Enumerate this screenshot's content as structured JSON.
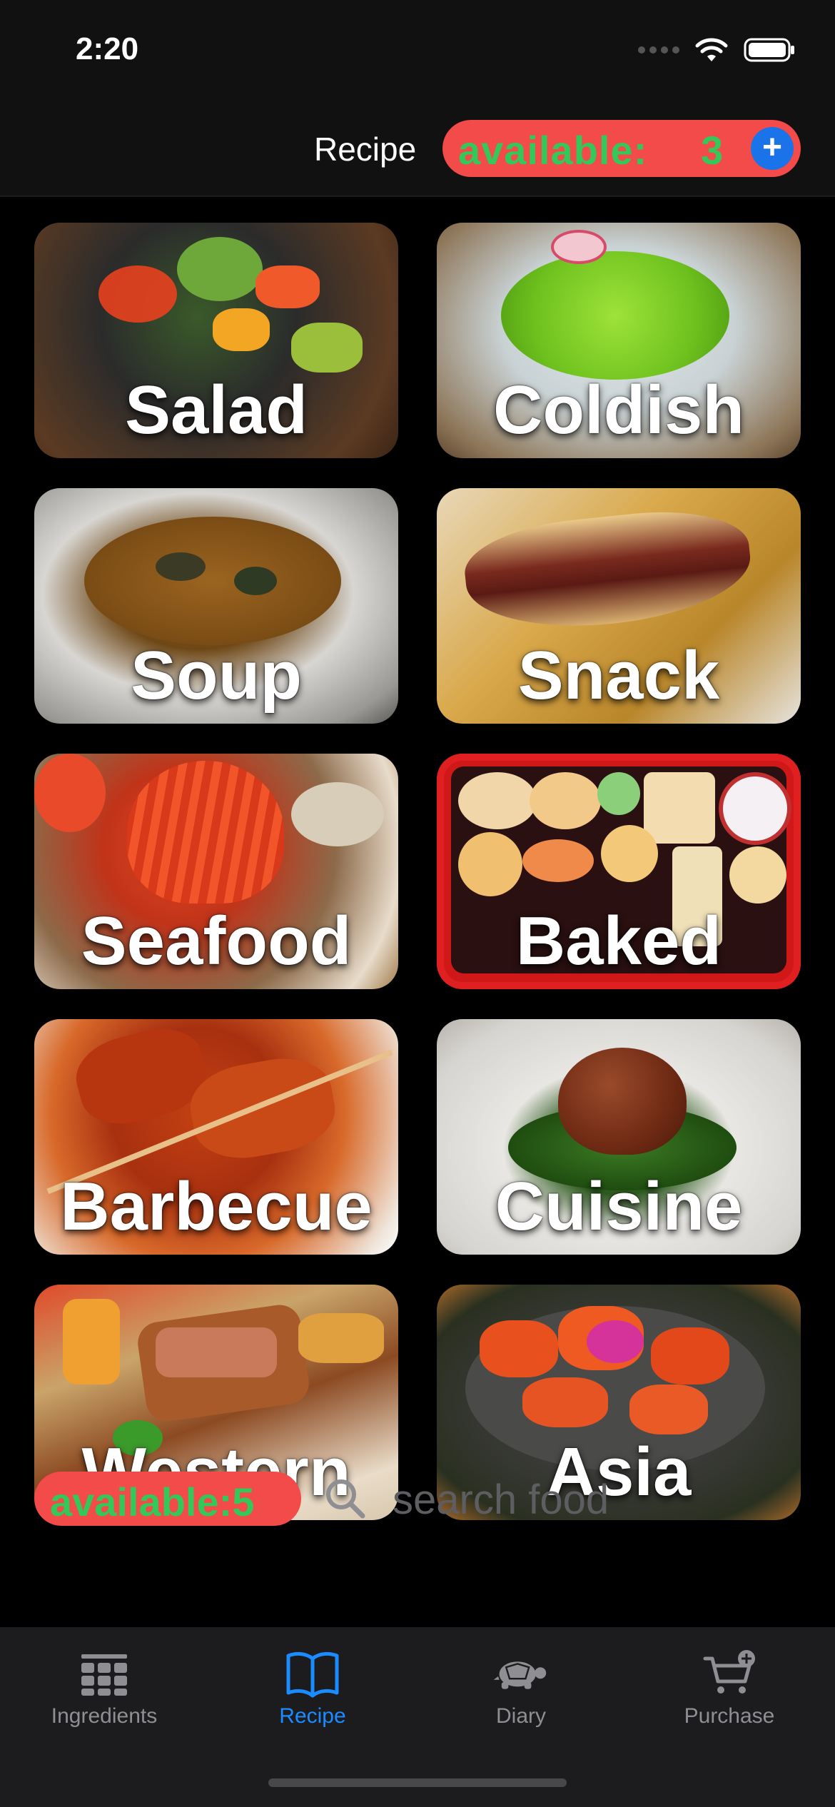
{
  "status_bar": {
    "time": "2:20"
  },
  "header": {
    "title": "Recipe",
    "available_label": "available:",
    "available_count": "3",
    "add_symbol": "+"
  },
  "categories": [
    {
      "label": "Salad"
    },
    {
      "label": "Coldish"
    },
    {
      "label": "Soup"
    },
    {
      "label": "Snack"
    },
    {
      "label": "Seafood"
    },
    {
      "label": "Baked"
    },
    {
      "label": "Barbecue"
    },
    {
      "label": "Cuisine"
    },
    {
      "label": "Western"
    },
    {
      "label": "Asia"
    }
  ],
  "bottom": {
    "available_text": "available:5",
    "search_placeholder": "search food"
  },
  "tabs": [
    {
      "label": "Ingredients",
      "icon": "grid-icon"
    },
    {
      "label": "Recipe",
      "icon": "book-icon"
    },
    {
      "label": "Diary",
      "icon": "turtle-icon"
    },
    {
      "label": "Purchase",
      "icon": "cart-icon"
    }
  ],
  "colors": {
    "accent": "#1a8cff",
    "pill_red": "#f34a4a",
    "available_green": "#34c759"
  }
}
